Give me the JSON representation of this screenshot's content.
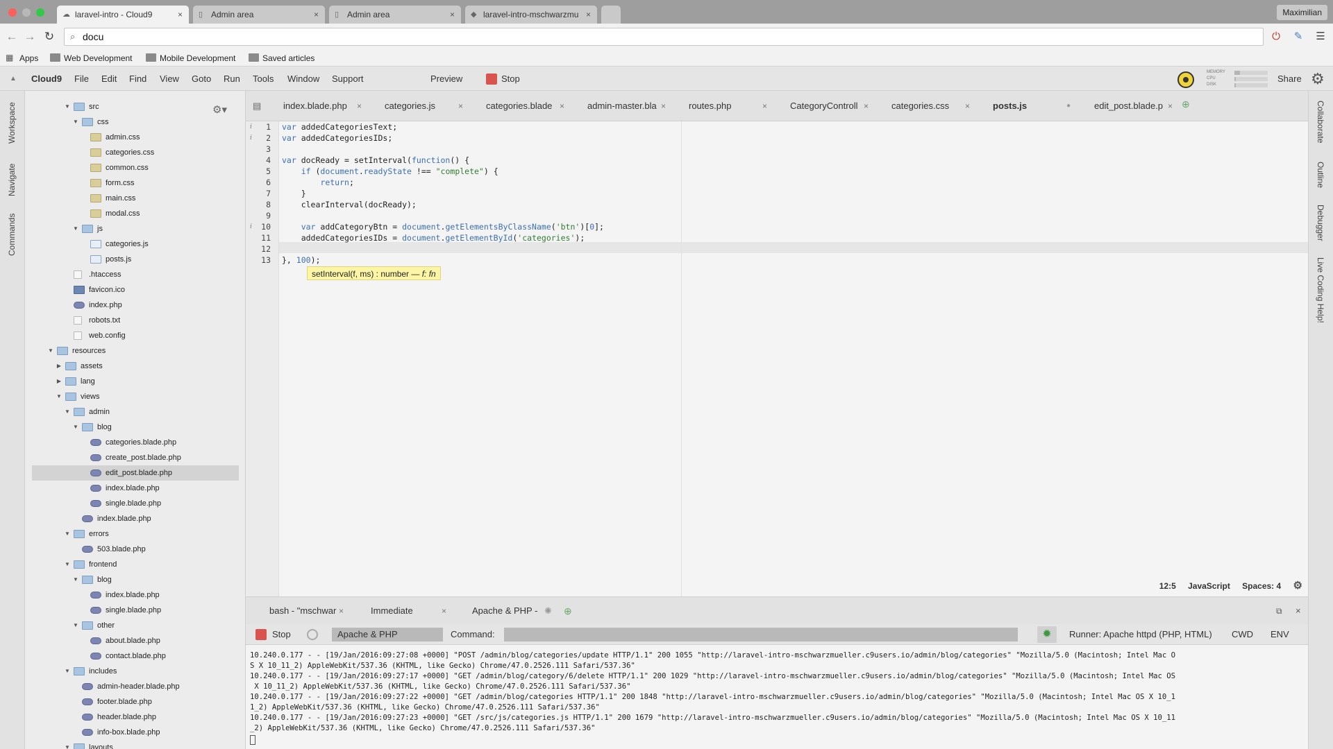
{
  "browser": {
    "tabs": [
      {
        "title": "laravel-intro - Cloud9",
        "active": true
      },
      {
        "title": "Admin area",
        "active": false
      },
      {
        "title": "Admin area",
        "active": false
      },
      {
        "title": "laravel-intro-mschwarzmu",
        "active": false
      }
    ],
    "user": "Maximilian",
    "address": "docu",
    "bookmarks": [
      "Apps",
      "Web Development",
      "Mobile Development",
      "Saved articles"
    ]
  },
  "menubar": {
    "brand": "Cloud9",
    "items": [
      "File",
      "Edit",
      "Find",
      "View",
      "Goto",
      "Run",
      "Tools",
      "Window",
      "Support"
    ],
    "preview": "Preview",
    "stop": "Stop",
    "meters": [
      "MEMORY",
      "CPU",
      "DISK"
    ],
    "share": "Share"
  },
  "left_panels": [
    "Workspace",
    "Navigate",
    "Commands"
  ],
  "right_panels": [
    "Collaborate",
    "Outline",
    "Debugger",
    "Live Coding Help!"
  ],
  "tree": [
    {
      "label": "src",
      "type": "folder",
      "level": 3,
      "open": true
    },
    {
      "label": "css",
      "type": "folder",
      "level": 4,
      "open": true
    },
    {
      "label": "admin.css",
      "type": "css",
      "level": 5
    },
    {
      "label": "categories.css",
      "type": "css",
      "level": 5
    },
    {
      "label": "common.css",
      "type": "css",
      "level": 5
    },
    {
      "label": "form.css",
      "type": "css",
      "level": 5
    },
    {
      "label": "main.css",
      "type": "css",
      "level": 5
    },
    {
      "label": "modal.css",
      "type": "css",
      "level": 5
    },
    {
      "label": "js",
      "type": "folder",
      "level": 4,
      "open": true
    },
    {
      "label": "categories.js",
      "type": "js",
      "level": 5
    },
    {
      "label": "posts.js",
      "type": "js",
      "level": 5
    },
    {
      "label": ".htaccess",
      "type": "txt",
      "level": 3
    },
    {
      "label": "favicon.ico",
      "type": "img",
      "level": 3
    },
    {
      "label": "index.php",
      "type": "php",
      "level": 3
    },
    {
      "label": "robots.txt",
      "type": "txt",
      "level": 3
    },
    {
      "label": "web.config",
      "type": "txt",
      "level": 3
    },
    {
      "label": "resources",
      "type": "folder",
      "level": 1,
      "open": true
    },
    {
      "label": "assets",
      "type": "folder",
      "level": 2,
      "open": false
    },
    {
      "label": "lang",
      "type": "folder",
      "level": 2,
      "open": false
    },
    {
      "label": "views",
      "type": "folder",
      "level": 2,
      "open": true
    },
    {
      "label": "admin",
      "type": "folder",
      "level": 3,
      "open": true
    },
    {
      "label": "blog",
      "type": "folder",
      "level": 4,
      "open": true
    },
    {
      "label": "categories.blade.php",
      "type": "php",
      "level": 5
    },
    {
      "label": "create_post.blade.php",
      "type": "php",
      "level": 5
    },
    {
      "label": "edit_post.blade.php",
      "type": "php",
      "level": 5,
      "selected": true
    },
    {
      "label": "index.blade.php",
      "type": "php",
      "level": 5
    },
    {
      "label": "single.blade.php",
      "type": "php",
      "level": 5
    },
    {
      "label": "index.blade.php",
      "type": "php",
      "level": 4
    },
    {
      "label": "errors",
      "type": "folder",
      "level": 3,
      "open": true
    },
    {
      "label": "503.blade.php",
      "type": "php",
      "level": 4
    },
    {
      "label": "frontend",
      "type": "folder",
      "level": 3,
      "open": true
    },
    {
      "label": "blog",
      "type": "folder",
      "level": 4,
      "open": true
    },
    {
      "label": "index.blade.php",
      "type": "php",
      "level": 5
    },
    {
      "label": "single.blade.php",
      "type": "php",
      "level": 5
    },
    {
      "label": "other",
      "type": "folder",
      "level": 4,
      "open": true
    },
    {
      "label": "about.blade.php",
      "type": "php",
      "level": 5
    },
    {
      "label": "contact.blade.php",
      "type": "php",
      "level": 5
    },
    {
      "label": "includes",
      "type": "folder",
      "level": 3,
      "open": true
    },
    {
      "label": "admin-header.blade.php",
      "type": "php",
      "level": 4
    },
    {
      "label": "footer.blade.php",
      "type": "php",
      "level": 4
    },
    {
      "label": "header.blade.php",
      "type": "php",
      "level": 4
    },
    {
      "label": "info-box.blade.php",
      "type": "php",
      "level": 4
    },
    {
      "label": "layouts",
      "type": "folder",
      "level": 3,
      "open": true
    }
  ],
  "editor_tabs": [
    {
      "label": "index.blade.php",
      "active": false
    },
    {
      "label": "categories.js",
      "active": false
    },
    {
      "label": "categories.blade",
      "active": false
    },
    {
      "label": "admin-master.bla",
      "active": false
    },
    {
      "label": "routes.php",
      "active": false
    },
    {
      "label": "CategoryControll",
      "active": false
    },
    {
      "label": "categories.css",
      "active": false
    },
    {
      "label": "posts.js",
      "active": true,
      "modified": true
    },
    {
      "label": "edit_post.blade.p",
      "active": false
    }
  ],
  "code": {
    "lines": [
      {
        "n": "1",
        "mark": "i"
      },
      {
        "n": "2",
        "mark": "i"
      },
      {
        "n": "3"
      },
      {
        "n": "4"
      },
      {
        "n": "5"
      },
      {
        "n": "6"
      },
      {
        "n": "7"
      },
      {
        "n": "8"
      },
      {
        "n": "9"
      },
      {
        "n": "10",
        "mark": "i"
      },
      {
        "n": "11"
      },
      {
        "n": "12"
      },
      {
        "n": "13"
      }
    ],
    "tooltip_sig": "setInterval(f, ms) : number — ",
    "tooltip_tail": "f: fn"
  },
  "status": {
    "position": "12:5",
    "language": "JavaScript",
    "indent": "Spaces: 4"
  },
  "console": {
    "tabs": [
      {
        "label": "bash - \"mschwar",
        "active": false
      },
      {
        "label": "Immediate",
        "active": false
      },
      {
        "label": "Apache & PHP -",
        "active": true
      }
    ],
    "stop": "Stop",
    "runner_select": "Apache & PHP",
    "command_label": "Command:",
    "runner_info": "Runner: Apache httpd (PHP, HTML)",
    "cwd": "CWD",
    "env": "ENV",
    "log": [
      "10.240.0.177 - - [19/Jan/2016:09:27:08 +0000] \"POST /admin/blog/categories/update HTTP/1.1\" 200 1055 \"http://laravel-intro-mschwarzmueller.c9users.io/admin/blog/categories\" \"Mozilla/5.0 (Macintosh; Intel Mac O",
      "S X 10_11_2) AppleWebKit/537.36 (KHTML, like Gecko) Chrome/47.0.2526.111 Safari/537.36\"",
      "10.240.0.177 - - [19/Jan/2016:09:27:17 +0000] \"GET /admin/blog/category/6/delete HTTP/1.1\" 200 1029 \"http://laravel-intro-mschwarzmueller.c9users.io/admin/blog/categories\" \"Mozilla/5.0 (Macintosh; Intel Mac OS",
      " X 10_11_2) AppleWebKit/537.36 (KHTML, like Gecko) Chrome/47.0.2526.111 Safari/537.36\"",
      "10.240.0.177 - - [19/Jan/2016:09:27:22 +0000] \"GET /admin/blog/categories HTTP/1.1\" 200 1848 \"http://laravel-intro-mschwarzmueller.c9users.io/admin/blog/categories\" \"Mozilla/5.0 (Macintosh; Intel Mac OS X 10_1",
      "1_2) AppleWebKit/537.36 (KHTML, like Gecko) Chrome/47.0.2526.111 Safari/537.36\"",
      "10.240.0.177 - - [19/Jan/2016:09:27:23 +0000] \"GET /src/js/categories.js HTTP/1.1\" 200 1679 \"http://laravel-intro-mschwarzmueller.c9users.io/admin/blog/categories\" \"Mozilla/5.0 (Macintosh; Intel Mac OS X 10_11",
      "_2) AppleWebKit/537.36 (KHTML, like Gecko) Chrome/47.0.2526.111 Safari/537.36\""
    ]
  }
}
